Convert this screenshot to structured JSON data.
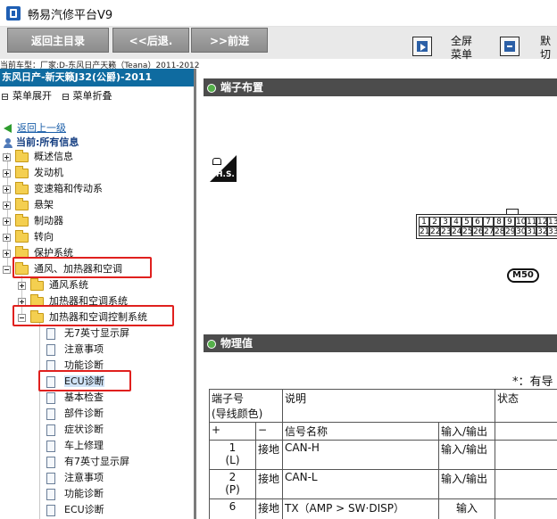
{
  "window": {
    "title": "畅易汽修平台V9"
  },
  "toolbar": {
    "home_label": "返回主目录",
    "back_label": "<<后退.",
    "forward_label": ">>前进",
    "fullscreen_label_1": "全屏",
    "fullscreen_label_2": "菜单",
    "default_label_1": "默",
    "default_label_2": "切"
  },
  "model_line": "当前车型：厂家:D-东风日产天籁（Teana）2011-2012",
  "sidebar": {
    "header": "东风日产-新天籁J32(公爵)-2011",
    "expand_label": "菜单展开",
    "collapse_label": "菜单折叠",
    "back_label": "返回上一级",
    "current_label": "当前:所有信息",
    "top_items": [
      "概述信息",
      "发动机",
      "变速箱和传动系",
      "悬架",
      "制动器",
      "转向",
      "保护系统",
      "通风、加热器和空调"
    ],
    "sub_items": [
      "通风系统",
      "加热器和空调系统",
      "加热器和空调控制系统"
    ],
    "leaf_items": [
      "无7英寸显示屏",
      "注意事项",
      "功能诊断",
      "ECU诊断",
      "基本检查",
      "部件诊断",
      "症状诊断",
      "车上修理",
      "有7英寸显示屏",
      "注意事项",
      "功能诊断",
      "ECU诊断"
    ]
  },
  "content": {
    "section1_title": "端子布置",
    "hs_label": "H.S.",
    "connector_top_pins": [
      "1",
      "2",
      "3",
      "4",
      "5",
      "6",
      "7",
      "8",
      "9",
      "10",
      "11",
      "12",
      "13"
    ],
    "connector_bottom_pins": [
      "21",
      "22",
      "23",
      "24",
      "25",
      "26",
      "27",
      "28",
      "29",
      "30",
      "31",
      "32",
      "33"
    ],
    "connector_code": "M50",
    "section2_title": "物理值",
    "note": "*：有导",
    "table": {
      "headers": {
        "terminal": "端子号",
        "wire_color": "(导线颜色)",
        "description": "说明",
        "status": "状态",
        "plus": "+",
        "minus": "−",
        "signal": "信号名称",
        "io": "输入/输出"
      },
      "rows": [
        {
          "num": "1",
          "color": "(L)",
          "minus": "接地",
          "signal": "CAN-H",
          "io": "输入/输出"
        },
        {
          "num": "2",
          "color": "(P)",
          "minus": "接地",
          "signal": "CAN-L",
          "io": "输入/输出"
        },
        {
          "num": "6",
          "color": "",
          "minus": "接地",
          "signal": "TX（AMP > SW·DISP）",
          "io": "输入"
        }
      ]
    }
  }
}
